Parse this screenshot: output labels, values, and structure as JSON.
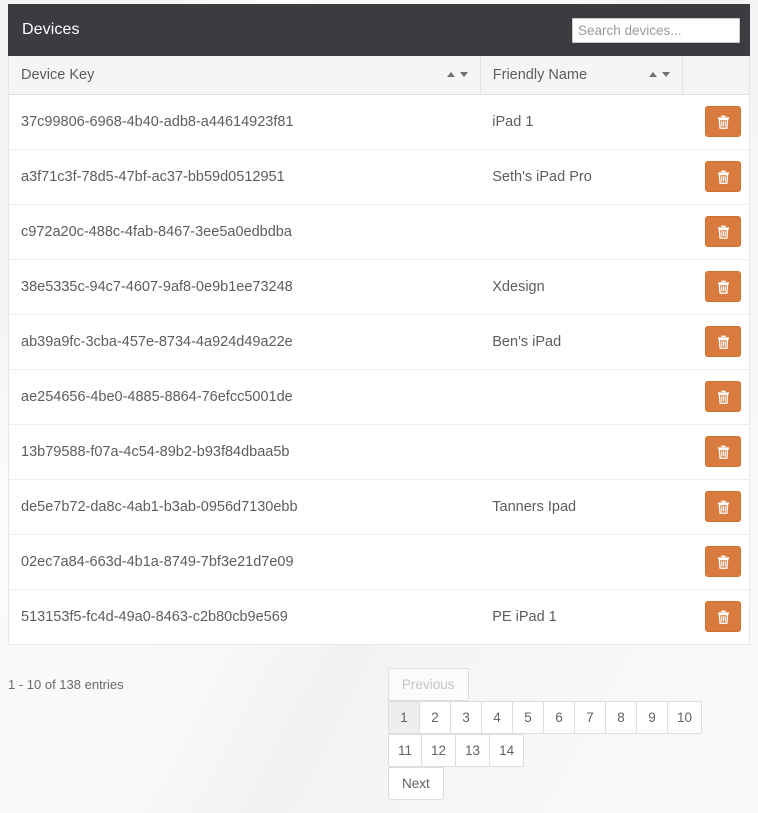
{
  "panel": {
    "title": "Devices",
    "search": {
      "placeholder": "Search devices...",
      "value": ""
    }
  },
  "table": {
    "columns": [
      {
        "label": "Device Key",
        "sortable": true
      },
      {
        "label": "Friendly Name",
        "sortable": true
      },
      {
        "label": "",
        "sortable": false
      }
    ],
    "sort_icons": {
      "asc": "sort-ascending-icon",
      "desc": "sort-descending-icon"
    },
    "row_action": {
      "icon": "trash-icon",
      "label": "",
      "color": "#d97b3e"
    },
    "rows": [
      {
        "device_key": "37c99806-6968-4b40-adb8-a44614923f81",
        "friendly_name": "iPad 1"
      },
      {
        "device_key": "a3f71c3f-78d5-47bf-ac37-bb59d0512951",
        "friendly_name": "Seth's iPad Pro"
      },
      {
        "device_key": "c972a20c-488c-4fab-8467-3ee5a0edbdba",
        "friendly_name": ""
      },
      {
        "device_key": "38e5335c-94c7-4607-9af8-0e9b1ee73248",
        "friendly_name": "Xdesign"
      },
      {
        "device_key": "ab39a9fc-3cba-457e-8734-4a924d49a22e",
        "friendly_name": "Ben's iPad"
      },
      {
        "device_key": "ae254656-4be0-4885-8864-76efcc5001de",
        "friendly_name": ""
      },
      {
        "device_key": "13b79588-f07a-4c54-89b2-b93f84dbaa5b",
        "friendly_name": ""
      },
      {
        "device_key": "de5e7b72-da8c-4ab1-b3ab-0956d7130ebb",
        "friendly_name": "Tanners Ipad"
      },
      {
        "device_key": "02ec7a84-663d-4b1a-8749-7bf3e21d7e09",
        "friendly_name": ""
      },
      {
        "device_key": "513153f5-fc4d-49a0-8463-c2b80cb9e569",
        "friendly_name": "PE iPad 1"
      }
    ]
  },
  "footer": {
    "entries_info": "1 - 10 of 138 entries",
    "pagination": {
      "previous_label": "Previous",
      "next_label": "Next",
      "previous_disabled": true,
      "active_page": "1",
      "pages": [
        "1",
        "2",
        "3",
        "4",
        "5",
        "6",
        "7",
        "8",
        "9",
        "10",
        "11",
        "12",
        "13",
        "14"
      ]
    }
  },
  "colors": {
    "header_bg": "#3b3b40",
    "accent_orange": "#d97b3e",
    "page_bg": "#f7f7f7"
  }
}
